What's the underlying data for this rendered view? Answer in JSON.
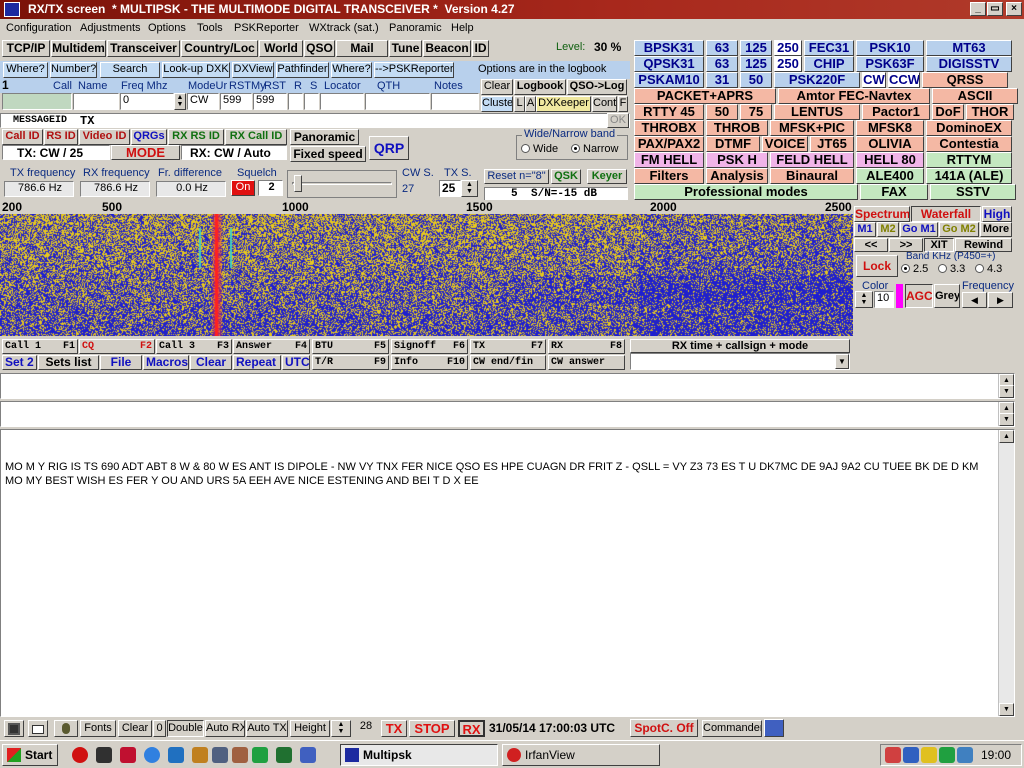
{
  "window": {
    "title": "RX/TX screen  * MULTIPSK - THE MULTIMODE DIGITAL TRANSCEIVER *  Version 4.27",
    "minimize": "_",
    "maximize": "▭",
    "close": "×"
  },
  "menu": [
    "Configuration",
    "Adjustments",
    "Options",
    "Tools",
    "PSKReporter",
    "WXtrack (sat.)",
    "Panoramic",
    "Help"
  ],
  "toolbar1": {
    "buttons": [
      "TCP/IP",
      "Multidem",
      "Transceiver",
      "Country/Loc",
      "World",
      "QSO",
      "Mail",
      "Tune",
      "Beacon",
      "ID"
    ],
    "level_label": "Level:",
    "level_value": "30 %"
  },
  "toolbar2": {
    "buttons": [
      "Where?",
      "Number?",
      "Search",
      "Look-up DXK",
      "DXView",
      "Pathfinder",
      "Where?",
      "-->PSKReporter"
    ],
    "logbook_note": "Options are in the logbook"
  },
  "qso_fields": {
    "headers": [
      "Call",
      "Name",
      "Freq Mhz",
      "ModeUr",
      "RSTMy",
      "RST",
      "R",
      "S",
      "Locator",
      "QTH",
      "Notes"
    ],
    "row_num": "1",
    "freq": "0",
    "mode": "CW",
    "rst_sent": "599",
    "rst_rcvd": "599"
  },
  "log_buttons": {
    "clear": "Clear",
    "logbook": "Logbook",
    "qso_log": "QSO->Log",
    "cluster": "Cluster",
    "l": "L",
    "a": "A",
    "dxkeeper": "DXKeeper",
    "cont": "Cont",
    "f": "F"
  },
  "message_bar": {
    "label": "MESSAGEID",
    "tx": "TX",
    "ok": "OK"
  },
  "id_buttons": {
    "call_id": "Call ID",
    "rs_id": "RS ID",
    "video_id": "Video ID",
    "qrgs": "QRGs",
    "rx_rs_id": "RX RS ID",
    "rx_call_id": "RX Call ID"
  },
  "mode_row": {
    "tx": "TX: CW / 25",
    "mode": "MODE",
    "rx": "RX: CW / Auto"
  },
  "panoramic": {
    "panoramic": "Panoramic",
    "fixed_speed": "Fixed speed",
    "qrp": "QRP"
  },
  "band": {
    "title": "Wide/Narrow band",
    "wide": "Wide",
    "narrow": "Narrow",
    "selected": "Narrow"
  },
  "freqs": {
    "tx_label": "TX frequency",
    "tx_value": "786.6 Hz",
    "rx_label": "RX frequency",
    "rx_value": "786.6 Hz",
    "diff_label": "Fr. difference",
    "diff_value": "0.0 Hz",
    "squelch_label": "Squelch",
    "squelch_on": "On",
    "squelch_value": "2",
    "cw_s_label": "CW S.",
    "cw_s_value": "27",
    "tx_s_label": "TX S.",
    "tx_s_value": "25",
    "reset": "Reset n=\"8\"",
    "qsk": "QSK",
    "keyer": "Keyer",
    "snr_n": "5",
    "snr": "S/N=-15 dB"
  },
  "modes": {
    "colors": {
      "blue": "#b8d0ec",
      "white": "#ffffff",
      "salmon": "#f4b8a4",
      "pink": "#f0b4e8",
      "green": "#c4e8c0",
      "grey": "#d4d0c8",
      "blue_text": "#00008b"
    },
    "rows": [
      [
        {
          "t": "BPSK31",
          "c": "blue"
        },
        {
          "t": "63",
          "c": "blue"
        },
        {
          "t": "125",
          "c": "blue"
        },
        {
          "t": "250",
          "c": "white"
        },
        {
          "t": "FEC31",
          "c": "blue"
        },
        {
          "t": "PSK10",
          "c": "blue"
        },
        {
          "t": "MT63",
          "c": "blue"
        }
      ],
      [
        {
          "t": "QPSK31",
          "c": "blue"
        },
        {
          "t": "63",
          "c": "blue"
        },
        {
          "t": "125",
          "c": "blue"
        },
        {
          "t": "250",
          "c": "white"
        },
        {
          "t": "CHIP",
          "c": "blue"
        },
        {
          "t": "PSK63F",
          "c": "blue"
        },
        {
          "t": "DIGISSTV",
          "c": "blue"
        }
      ],
      [
        {
          "t": "PSKAM10",
          "c": "blue"
        },
        {
          "t": "31",
          "c": "blue"
        },
        {
          "t": "50",
          "c": "blue"
        },
        {
          "t": "PSK220F",
          "c": "blue"
        },
        {
          "t": "CW",
          "c": "white"
        },
        {
          "t": "CCW",
          "c": "white"
        },
        {
          "t": "QRSS",
          "c": "salmon"
        }
      ],
      [
        {
          "t": "PACKET+APRS",
          "c": "salmon"
        },
        {
          "t": "Amtor FEC-Navtex",
          "c": "salmon"
        },
        {
          "t": "ASCII",
          "c": "salmon"
        }
      ],
      [
        {
          "t": "RTTY 45",
          "c": "salmon"
        },
        {
          "t": "50",
          "c": "salmon"
        },
        {
          "t": "75",
          "c": "salmon"
        },
        {
          "t": "LENTUS",
          "c": "salmon"
        },
        {
          "t": "Pactor1",
          "c": "salmon"
        },
        {
          "t": "DoF",
          "c": "salmon"
        },
        {
          "t": "THOR",
          "c": "salmon"
        }
      ],
      [
        {
          "t": "THROBX",
          "c": "salmon"
        },
        {
          "t": "THROB",
          "c": "salmon"
        },
        {
          "t": "MFSK+PIC",
          "c": "salmon"
        },
        {
          "t": "MFSK8",
          "c": "salmon"
        },
        {
          "t": "DominoEX",
          "c": "salmon"
        }
      ],
      [
        {
          "t": "PAX/PAX2",
          "c": "salmon"
        },
        {
          "t": "DTMF",
          "c": "salmon"
        },
        {
          "t": "VOICE",
          "c": "salmon"
        },
        {
          "t": "JT65",
          "c": "salmon"
        },
        {
          "t": "OLIVIA",
          "c": "salmon"
        },
        {
          "t": "Contestia",
          "c": "salmon"
        }
      ],
      [
        {
          "t": "FM HELL",
          "c": "pink"
        },
        {
          "t": "PSK H",
          "c": "pink"
        },
        {
          "t": "FELD HELL",
          "c": "pink"
        },
        {
          "t": "HELL 80",
          "c": "pink"
        },
        {
          "t": "RTTYM",
          "c": "green"
        }
      ],
      [
        {
          "t": "Filters",
          "c": "salmon"
        },
        {
          "t": "Analysis",
          "c": "salmon"
        },
        {
          "t": "Binaural",
          "c": "salmon"
        },
        {
          "t": "ALE400",
          "c": "green"
        },
        {
          "t": "141A (ALE)",
          "c": "green"
        }
      ],
      [
        {
          "t": "Professional modes",
          "c": "green"
        },
        {
          "t": "FAX",
          "c": "green"
        },
        {
          "t": "SSTV",
          "c": "green"
        }
      ]
    ]
  },
  "spectrum": {
    "ruler_ticks": [
      "200",
      "500",
      "1000",
      "1500",
      "2000",
      "2500"
    ],
    "spectrum": "Spectrum",
    "waterfall": "Waterfall",
    "high": "High",
    "m1": "M1",
    "m2": "M2",
    "go_m1": "Go M1",
    "go_m2": "Go M2",
    "more": "More",
    "prev": "<<",
    "next": ">>",
    "xit": "XIT",
    "rewind": "Rewind",
    "lock": "Lock",
    "band_khz": "Band KHz (P450=+)",
    "b25": "2.5",
    "b33": "3.3",
    "b43": "4.3",
    "band_selected": "2.5",
    "color_label": "Color",
    "color_value": "10",
    "agc": "AGC",
    "grey": "Grey",
    "frequency_label": "Frequency",
    "left": "◀",
    "right": "▶",
    "tx_marker_hz": 786.6
  },
  "fkeys": [
    {
      "t": "Call  1",
      "k": "F1"
    },
    {
      "t": "CQ",
      "k": "F2"
    },
    {
      "t": "Call  3",
      "k": "F3"
    },
    {
      "t": "Answer",
      "k": "F4"
    },
    {
      "t": "BTU",
      "k": "F5"
    },
    {
      "t": "Signoff",
      "k": "F6"
    },
    {
      "t": "TX",
      "k": "F7"
    },
    {
      "t": "RX",
      "k": "F8"
    },
    {
      "t": "Set 2"
    },
    {
      "t": "Sets list"
    },
    {
      "t": "File"
    },
    {
      "t": "Macros"
    },
    {
      "t": "Clear"
    },
    {
      "t": "Repeat"
    },
    {
      "t": "UTC"
    },
    {
      "t": "T/R",
      "k": "F9"
    },
    {
      "t": "Info",
      "k": "F10"
    },
    {
      "t": "CW end/fin"
    },
    {
      "t": "CW answer"
    }
  ],
  "rx_time": {
    "header": "RX time + callsign + mode"
  },
  "rx_text": "MO M Y RIG IS TS 690 ADT ABT 8 W & 80 W ES ANT IS DIPOLE - NW VY TNX FER NICE QSO ES HPE CUAGN DR FRIT Z - QSLL = VY Z3 73 ES T U DK7MC DE 9AJ 9A2 CU TUEE BK DE D KM MO MY BEST WISH ES FER Y OU AND URS 5A EEH AVE NICE ESTENING AND BEI T D X EE",
  "statusbar": {
    "fonts": "Fonts",
    "clear": "Clear",
    "zero": "0",
    "double": "Double",
    "auto_rx": "Auto RX",
    "auto_tx": "Auto TX",
    "height": "Height",
    "height_value": "28",
    "tx": "TX",
    "stop": "STOP",
    "rx": "RX",
    "datetime": "31/05/14 17:00:03 UTC",
    "spotc": "SpotC. Off",
    "commander": "Commander"
  },
  "taskbar": {
    "start": "Start",
    "task1": "Multipsk",
    "task2": "IrfanView",
    "clock": "19:00"
  }
}
